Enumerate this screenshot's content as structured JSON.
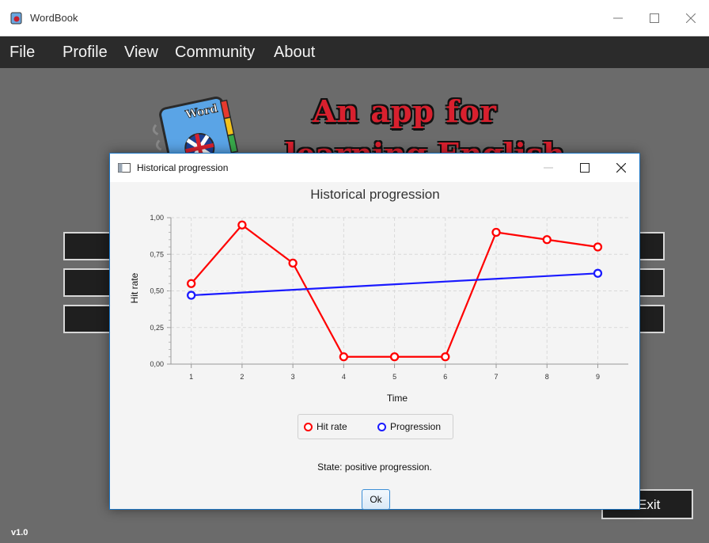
{
  "app": {
    "title": "WordBook",
    "menu": [
      "File",
      "Profile",
      "View",
      "Community",
      "About"
    ],
    "headline_line1": "An app for",
    "headline_line2": "learning English",
    "logo_book_text": "Word",
    "exit_label": "Exit",
    "version": "v1.0"
  },
  "dialog": {
    "window_title": "Historical progression",
    "state_text": "State: positive progression.",
    "ok_label": "Ok"
  },
  "chart_data": {
    "type": "line",
    "title": "Historical progression",
    "xlabel": "Time",
    "ylabel": "Hit rate",
    "x": [
      1,
      2,
      3,
      4,
      5,
      6,
      7,
      8,
      9
    ],
    "x_ticks": [
      "1",
      "2",
      "3",
      "4",
      "5",
      "6",
      "7",
      "8",
      "9"
    ],
    "y_ticks": [
      "0,00",
      "0,25",
      "0,50",
      "0,75",
      "1,00"
    ],
    "ylim": [
      0,
      1
    ],
    "grid": true,
    "legend_position": "bottom",
    "series": [
      {
        "name": "Hit rate",
        "color": "#ff0000",
        "x": [
          1,
          2,
          3,
          4,
          5,
          6,
          7,
          8,
          9
        ],
        "values": [
          0.55,
          0.95,
          0.69,
          0.05,
          0.05,
          0.05,
          0.9,
          0.85,
          0.8
        ]
      },
      {
        "name": "Progression",
        "color": "#1a1aff",
        "x": [
          1,
          9
        ],
        "values": [
          0.47,
          0.62
        ]
      }
    ]
  }
}
